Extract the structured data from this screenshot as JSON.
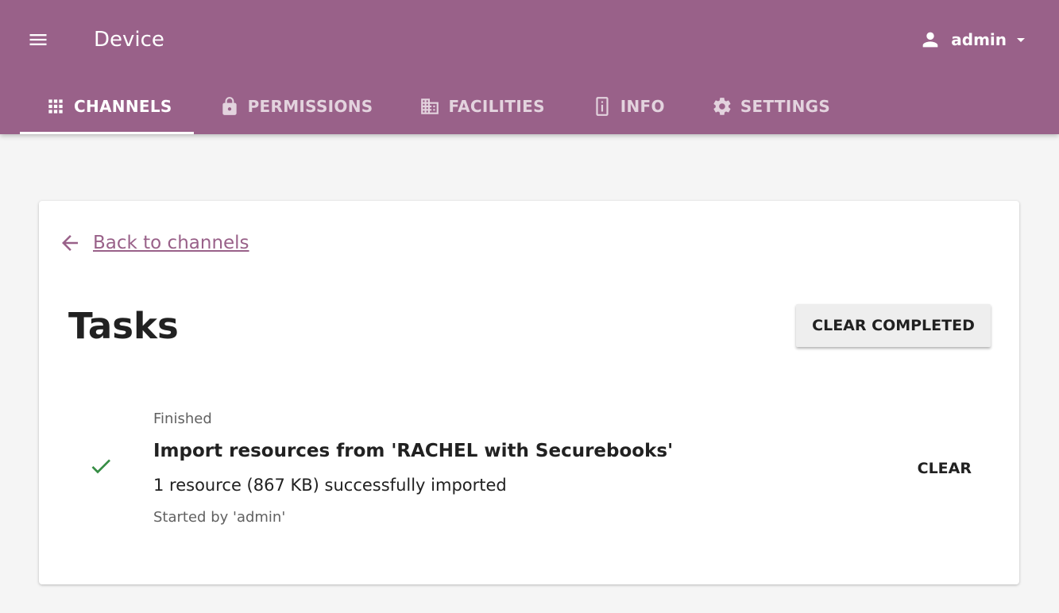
{
  "header": {
    "menu_icon": "hamburger-menu-icon",
    "title": "Device",
    "user": {
      "icon": "person-icon",
      "name": "admin",
      "caret_icon": "caret-down-icon"
    },
    "background_color": "#996189"
  },
  "tabs": [
    {
      "label": "CHANNELS",
      "icon": "apps-grid-icon",
      "active": true
    },
    {
      "label": "PERMISSIONS",
      "icon": "lock-icon",
      "active": false
    },
    {
      "label": "FACILITIES",
      "icon": "building-icon",
      "active": false
    },
    {
      "label": "INFO",
      "icon": "info-icon",
      "active": false
    },
    {
      "label": "SETTINGS",
      "icon": "gear-icon",
      "active": false
    }
  ],
  "main": {
    "back_link": {
      "icon": "arrow-back-icon",
      "label": "Back to channels"
    },
    "title": "Tasks",
    "clear_completed_label": "CLEAR COMPLETED",
    "tasks": [
      {
        "status": "Finished",
        "status_icon": "checkmark-icon",
        "title": "Import resources from 'RACHEL with Securebooks'",
        "detail": "1 resource (867 KB) successfully imported",
        "started_by": "Started by 'admin'",
        "clear_label": "CLEAR"
      }
    ]
  },
  "colors": {
    "accent": "#996189",
    "success": "#368d44",
    "page_background": "#f5f5f5"
  }
}
